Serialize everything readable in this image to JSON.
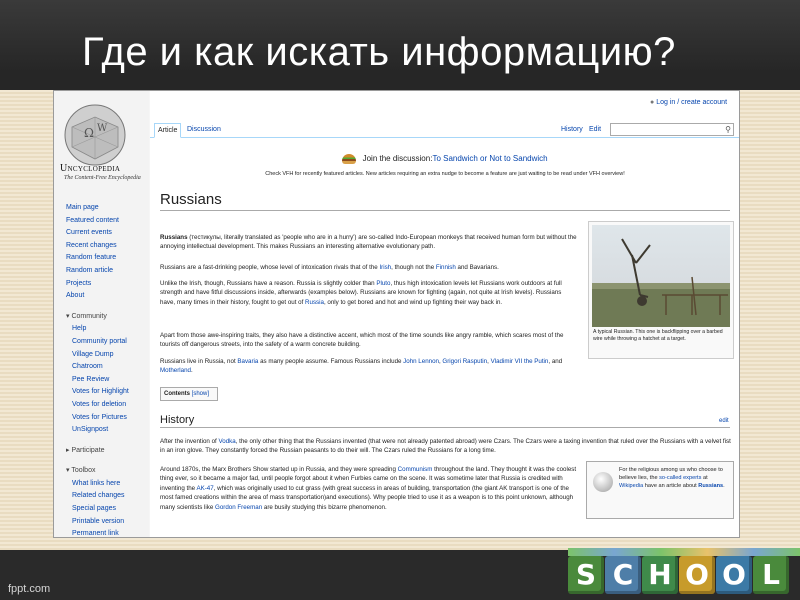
{
  "slide": {
    "title": "Где и как искать информацию?",
    "footer": "fppt.com",
    "school_letters": [
      "S",
      "C",
      "H",
      "O",
      "O",
      "L"
    ]
  },
  "browser": {
    "login": "Log in / create account",
    "tabs": [
      "Article",
      "Discussion"
    ],
    "right_tabs": [
      "History",
      "Edit"
    ],
    "search_placeholder": ""
  },
  "logo": {
    "title": "Uncyclopedia",
    "subtitle": "The Content-Free Encyclopedia"
  },
  "nav": {
    "main": [
      "Main page",
      "Featured content",
      "Current events",
      "Recent changes",
      "Random feature",
      "Random article",
      "Projects",
      "About"
    ],
    "community_head": "▾ Community",
    "community": [
      "Help",
      "Community portal",
      "Village Dump",
      "Chatroom",
      "Pee Review",
      "Votes for Highlight",
      "Votes for deletion",
      "Votes for Pictures",
      "UnSignpost"
    ],
    "participate_head": "▸ Participate",
    "toolbox_head": "▾ Toolbox",
    "toolbox": [
      "What links here",
      "Related changes",
      "Special pages",
      "Printable version",
      "Permanent link"
    ]
  },
  "notice": {
    "join": "Join the discussion:",
    "link": "To Sandwich or Not to Sandwich",
    "vfh_line": "Check VFH for recently featured articles. New articles requiring an extra nudge to become a feature are just waiting to be read under VFH overview!"
  },
  "article": {
    "title": "Russians",
    "p1_bold": "Russians",
    "p1": " (тестикулы, literally translated as 'people who are in a hurry') are so-called Indo-European monkeys that received human form but without the annoying intellectual development. This makes Russians an interesting alternative evolutionary path.",
    "p2_a": "Russians are a fast-drinking people, whose level of intoxication rivals that of the ",
    "p2_l1": "Irish",
    "p2_b": ", though not the ",
    "p2_l2": "Finnish",
    "p2_c": " and Bavarians.",
    "p3_a": "Unlike the Irish, though, Russians have a reason. Russia is slightly colder than ",
    "p3_l1": "Pluto",
    "p3_b": ", thus high intoxication levels let Russians work outdoors at full strength and have fitful discussions inside, afterwards (examples below). Russians are known for fighting (again, not quite at Irish levels). Russians have, many times in their history, fought to get out of ",
    "p3_l2": "Russia",
    "p3_c": ", only to get bored and hot and wind up fighting their way back in.",
    "p4": "Apart from those awe-inspiring traits, they also have a distinctive accent, which most of the time sounds like angry ramble, which scares most of the tourists off dangerous streets, into the safety of a warm concrete building.",
    "p5_a": "Russians live in Russia, not ",
    "p5_l1": "Bavaria",
    "p5_b": " as many people assume. Famous Russians include ",
    "p5_l2": "John Lennon",
    "p5_c": ", ",
    "p5_l3": "Grigori Rasputin",
    "p5_d": ", ",
    "p5_l4": "Vladimir VII the Putin",
    "p5_e": ", and ",
    "p5_l5": "Motherland",
    "p5_f": ".",
    "caption": "A typical Russian. This one is backflipping over a barbed wire while throwing a hatchet at a target.",
    "contents": "Contents",
    "contents_show": "[show]",
    "history_title": "History",
    "edit": "edit",
    "h1_a": "After the invention of ",
    "h1_l1": "Vodka",
    "h1_b": ", the only other thing that the Russians invented (that were not already patented abroad) were Czars. The Czars were a taxing invention that ruled over the Russians with a velvet fist in an iron glove. They constantly forced the Russian peasants to do their will. The Czars ruled the Russians for a long time.",
    "h2_a": "Around 1870s, the Marx Brothers Show started up in Russia, and they were spreading ",
    "h2_l1": "Communism",
    "h2_b": " throughout the land. They thought it was the coolest thing ever, so it became a major fad, until people forgot about it when Furbies came on the scene. It was sometime later that Russia is credited with inventing the ",
    "h2_l2": "AK-47",
    "h2_c": ", which was originally used to cut grass (with great success in areas of building, transportation (the giant AK transport is one of the most famed creations within the area of mass transportation)and executions). Why people tried to use it as a weapon is to this point unknown, although many scientists like ",
    "h2_l3": "Gordon Freeman",
    "h2_d": " are busily studying this bizarre phenomenon.",
    "note_a": "For the religious among us who choose to believe lies, the ",
    "note_l1": "so-called experts",
    "note_b": " at ",
    "note_l2": "Wikipedia",
    "note_c": " have an article about ",
    "note_l3": "Russians",
    "note_d": "."
  }
}
